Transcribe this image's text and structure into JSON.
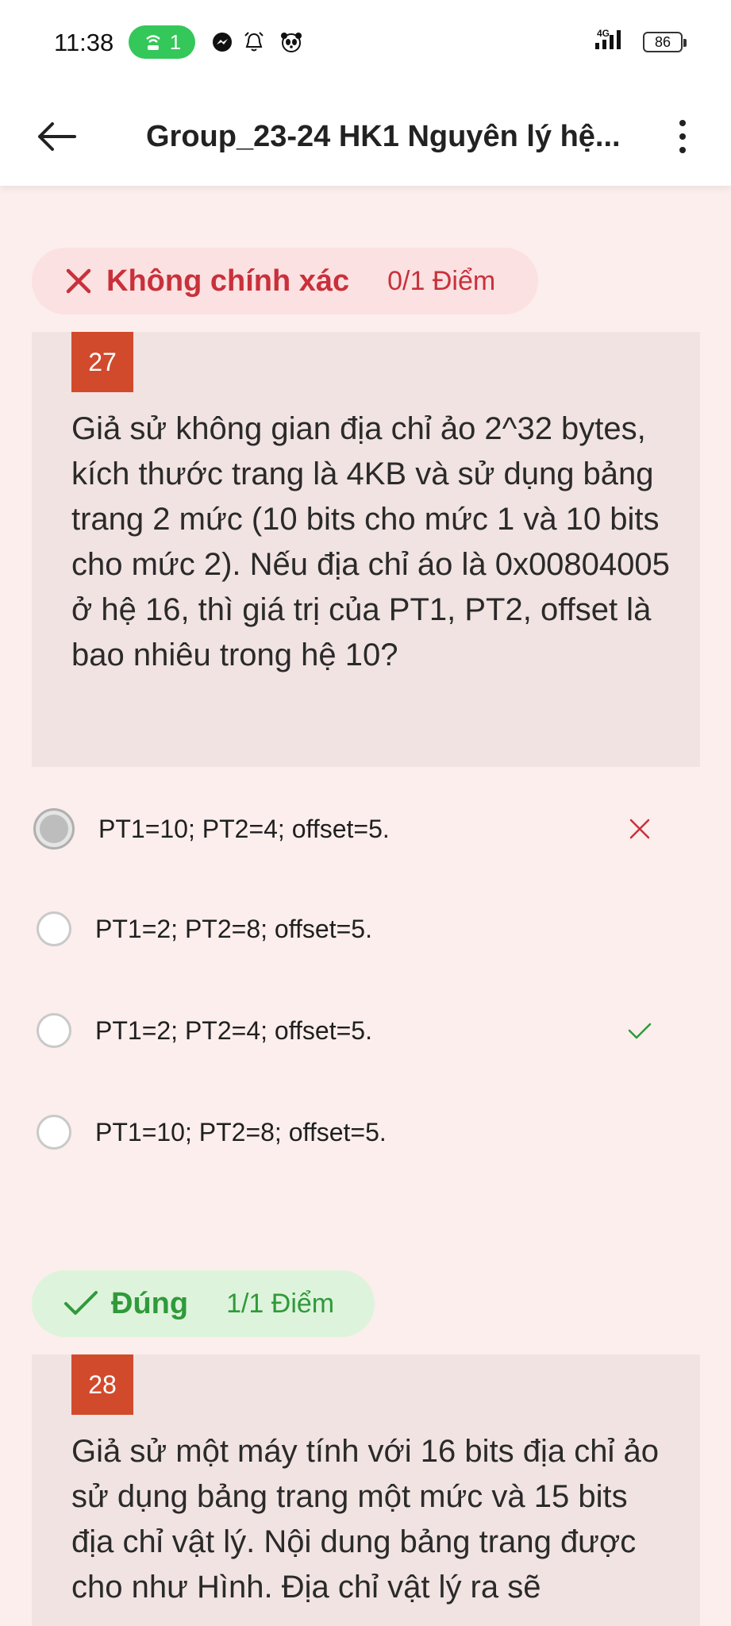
{
  "status_bar": {
    "time": "11:38",
    "hotspot_count": "1",
    "network": "4G",
    "battery": "86"
  },
  "app_bar": {
    "title": "Group_23-24 HK1 Nguyên lý hệ..."
  },
  "questions": [
    {
      "result_status": "Không chính xác",
      "result_score": "0/1 Điểm",
      "number": "27",
      "text": "Giả sử không gian địa chỉ ảo 2^32 bytes, kích thước trang là 4KB và sử dụng bảng trang 2 mức (10 bits cho mức 1 và 10 bits cho mức 2). Nếu địa chỉ áo là 0x00804005 ở hệ 16, thì giá trị của PT1, PT2, offset là bao nhiêu trong hệ 10?",
      "options": [
        {
          "label": "PT1=10; PT2=4; offset=5.",
          "selected": true,
          "mark": "wrong"
        },
        {
          "label": "PT1=2; PT2=8; offset=5.",
          "selected": false,
          "mark": ""
        },
        {
          "label": "PT1=2; PT2=4; offset=5.",
          "selected": false,
          "mark": "correct"
        },
        {
          "label": "PT1=10; PT2=8; offset=5.",
          "selected": false,
          "mark": ""
        }
      ]
    },
    {
      "result_status": "Đúng",
      "result_score": "1/1 Điểm",
      "number": "28",
      "text": "Giả sử một máy tính với 16 bits địa chỉ ảo sử dụng bảng trang một mức và 15 bits địa chỉ vật lý. Nội dung bảng trang được cho như Hình. Địa chỉ vật lý ra sẽ"
    }
  ],
  "colors": {
    "wrong": "#c8313b",
    "correct": "#2f9a3a",
    "question_badge": "#d24a2c"
  }
}
